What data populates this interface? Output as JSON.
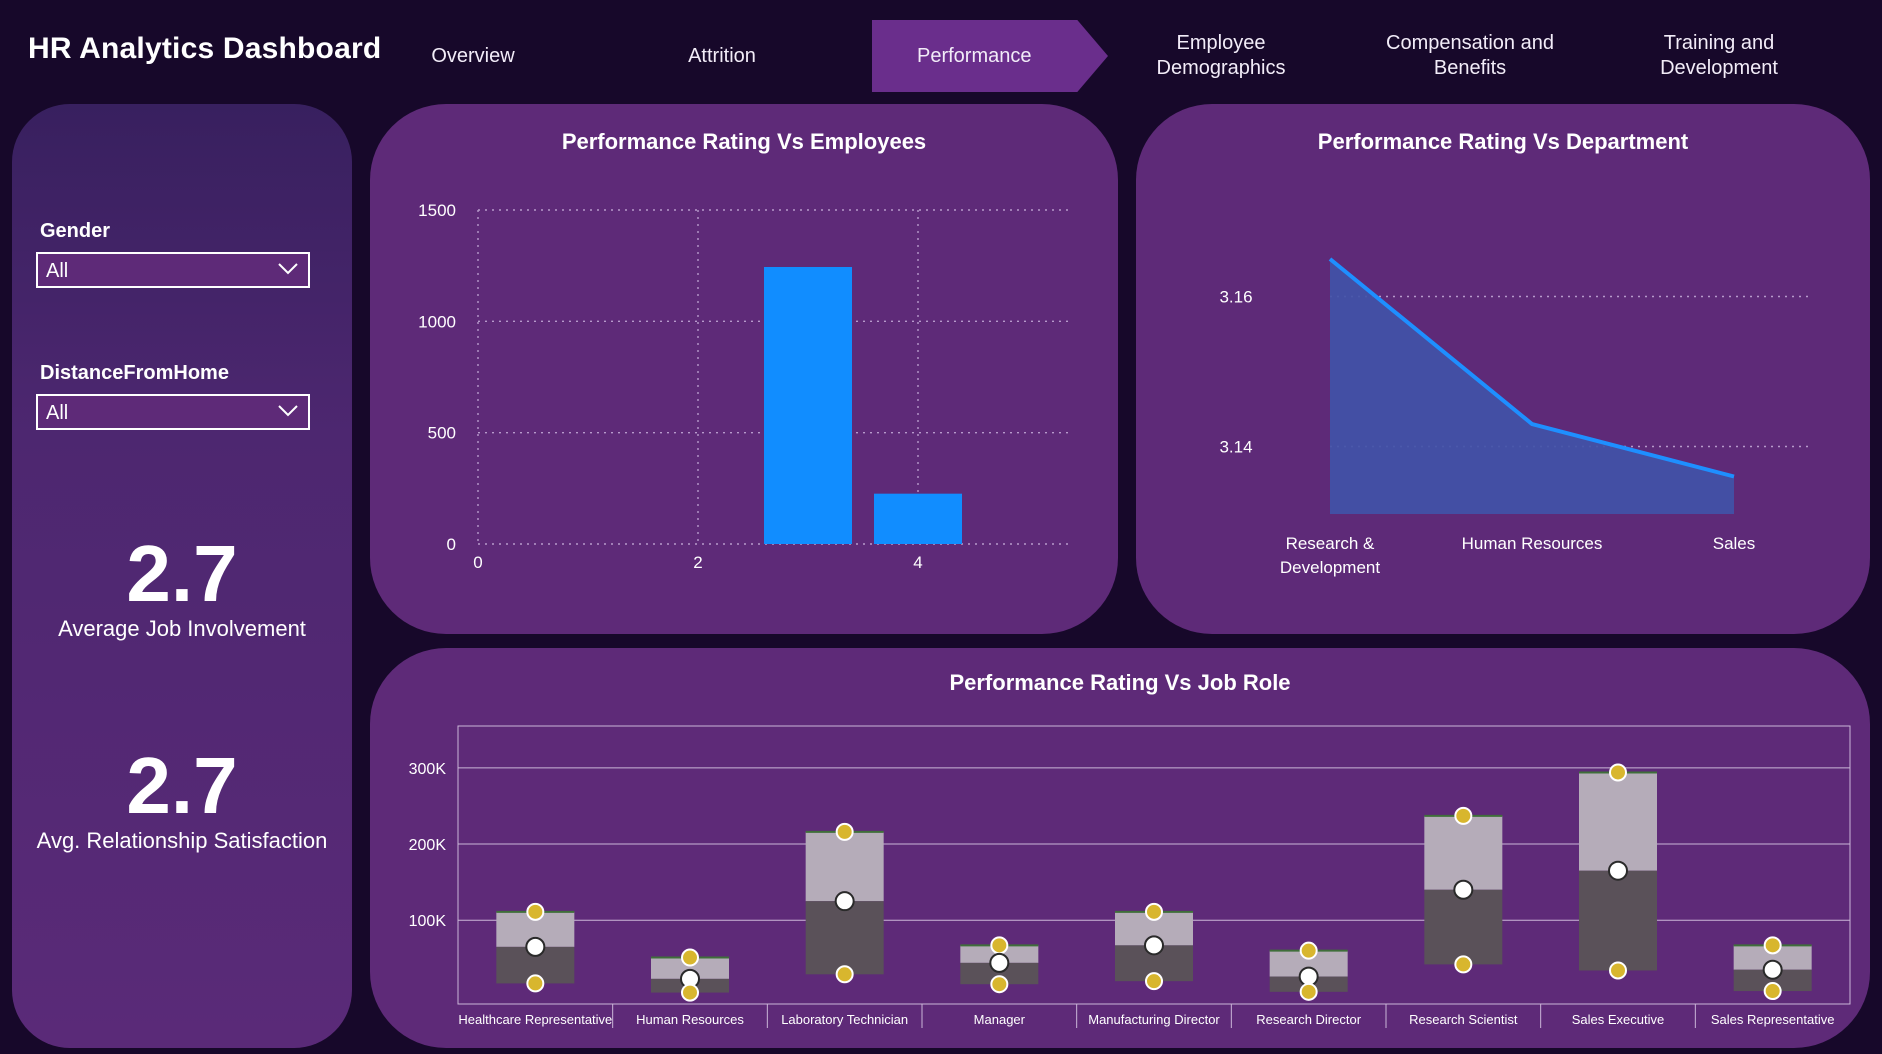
{
  "app": {
    "title": "HR Analytics Dashboard"
  },
  "nav": {
    "tabs": [
      {
        "label": "Overview"
      },
      {
        "label": "Attrition"
      },
      {
        "label": "Performance",
        "active": true
      },
      {
        "label": "Employee\nDemographics"
      },
      {
        "label": "Compensation and\nBenefits"
      },
      {
        "label": "Training and\nDevelopment"
      }
    ]
  },
  "filters": {
    "gender": {
      "label": "Gender",
      "value": "All"
    },
    "distance": {
      "label": "DistanceFromHome",
      "value": "All"
    }
  },
  "kpis": [
    {
      "value": "2.7",
      "label": "Average Job Involvement"
    },
    {
      "value": "2.7",
      "label": "Avg. Relationship Satisfaction"
    }
  ],
  "colors": {
    "background": "#17082a",
    "panel": "#5e2a78",
    "active_tab": "#6a2e8c",
    "bar_blue": "#118dff",
    "area_fill": "#4152a8",
    "line_blue": "#1e8fff",
    "box_upper": "#b5acb9",
    "box_lower": "#5a5159",
    "whisker_dot": "#d8b62e"
  },
  "chart_data": [
    {
      "type": "bar",
      "title": "Performance Rating Vs Employees",
      "xlabel": "",
      "ylabel": "",
      "x": [
        3,
        4
      ],
      "values": [
        1244,
        226
      ],
      "xlim": [
        0,
        5.4
      ],
      "ylim": [
        0,
        1500
      ],
      "xticks": [
        0,
        2,
        4
      ],
      "yticks": [
        0,
        500,
        1000,
        1500
      ],
      "grid": true
    },
    {
      "type": "area",
      "title": "Performance Rating Vs Department",
      "xlabel": "",
      "ylabel": "",
      "categories": [
        "Research &\nDevelopment",
        "Human Resources",
        "Sales"
      ],
      "values": [
        3.165,
        3.143,
        3.136
      ],
      "ylim": [
        3.131,
        3.171
      ],
      "yticks": [
        3.14,
        3.16
      ],
      "ytick_labels": [
        "3.14",
        "3.16"
      ],
      "grid": true
    },
    {
      "type": "box",
      "title": "Performance Rating Vs Job Role",
      "xlabel": "",
      "ylabel": "",
      "categories": [
        "Healthcare Representative",
        "Human Resources",
        "Laboratory Technician",
        "Manager",
        "Manufacturing Director",
        "Research Director",
        "Research Scientist",
        "Sales Executive",
        "Sales Representative"
      ],
      "min": [
        17000,
        5000,
        29000,
        16000,
        20000,
        6000,
        42000,
        34000,
        7000
      ],
      "median": [
        65000,
        23000,
        125000,
        44000,
        67000,
        26000,
        140000,
        165000,
        35000
      ],
      "max": [
        111000,
        51000,
        216000,
        67000,
        111000,
        60000,
        237000,
        294000,
        67000
      ],
      "ylim": [
        -10000,
        355000
      ],
      "yticks": [
        100000,
        200000,
        300000
      ],
      "ytick_labels": [
        "100K",
        "200K",
        "300K"
      ],
      "grid": true
    }
  ]
}
